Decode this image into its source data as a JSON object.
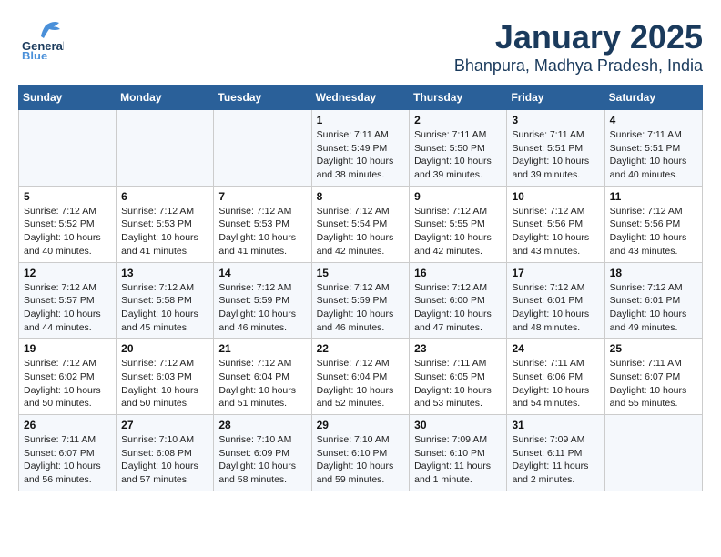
{
  "header": {
    "logo_general": "General",
    "logo_blue": "Blue",
    "title": "January 2025",
    "subtitle": "Bhanpura, Madhya Pradesh, India"
  },
  "days_of_week": [
    "Sunday",
    "Monday",
    "Tuesday",
    "Wednesday",
    "Thursday",
    "Friday",
    "Saturday"
  ],
  "weeks": [
    [
      {
        "day": "",
        "sunrise": "",
        "sunset": "",
        "daylight": ""
      },
      {
        "day": "",
        "sunrise": "",
        "sunset": "",
        "daylight": ""
      },
      {
        "day": "",
        "sunrise": "",
        "sunset": "",
        "daylight": ""
      },
      {
        "day": "1",
        "sunrise": "Sunrise: 7:11 AM",
        "sunset": "Sunset: 5:49 PM",
        "daylight": "Daylight: 10 hours and 38 minutes."
      },
      {
        "day": "2",
        "sunrise": "Sunrise: 7:11 AM",
        "sunset": "Sunset: 5:50 PM",
        "daylight": "Daylight: 10 hours and 39 minutes."
      },
      {
        "day": "3",
        "sunrise": "Sunrise: 7:11 AM",
        "sunset": "Sunset: 5:51 PM",
        "daylight": "Daylight: 10 hours and 39 minutes."
      },
      {
        "day": "4",
        "sunrise": "Sunrise: 7:11 AM",
        "sunset": "Sunset: 5:51 PM",
        "daylight": "Daylight: 10 hours and 40 minutes."
      }
    ],
    [
      {
        "day": "5",
        "sunrise": "Sunrise: 7:12 AM",
        "sunset": "Sunset: 5:52 PM",
        "daylight": "Daylight: 10 hours and 40 minutes."
      },
      {
        "day": "6",
        "sunrise": "Sunrise: 7:12 AM",
        "sunset": "Sunset: 5:53 PM",
        "daylight": "Daylight: 10 hours and 41 minutes."
      },
      {
        "day": "7",
        "sunrise": "Sunrise: 7:12 AM",
        "sunset": "Sunset: 5:53 PM",
        "daylight": "Daylight: 10 hours and 41 minutes."
      },
      {
        "day": "8",
        "sunrise": "Sunrise: 7:12 AM",
        "sunset": "Sunset: 5:54 PM",
        "daylight": "Daylight: 10 hours and 42 minutes."
      },
      {
        "day": "9",
        "sunrise": "Sunrise: 7:12 AM",
        "sunset": "Sunset: 5:55 PM",
        "daylight": "Daylight: 10 hours and 42 minutes."
      },
      {
        "day": "10",
        "sunrise": "Sunrise: 7:12 AM",
        "sunset": "Sunset: 5:56 PM",
        "daylight": "Daylight: 10 hours and 43 minutes."
      },
      {
        "day": "11",
        "sunrise": "Sunrise: 7:12 AM",
        "sunset": "Sunset: 5:56 PM",
        "daylight": "Daylight: 10 hours and 43 minutes."
      }
    ],
    [
      {
        "day": "12",
        "sunrise": "Sunrise: 7:12 AM",
        "sunset": "Sunset: 5:57 PM",
        "daylight": "Daylight: 10 hours and 44 minutes."
      },
      {
        "day": "13",
        "sunrise": "Sunrise: 7:12 AM",
        "sunset": "Sunset: 5:58 PM",
        "daylight": "Daylight: 10 hours and 45 minutes."
      },
      {
        "day": "14",
        "sunrise": "Sunrise: 7:12 AM",
        "sunset": "Sunset: 5:59 PM",
        "daylight": "Daylight: 10 hours and 46 minutes."
      },
      {
        "day": "15",
        "sunrise": "Sunrise: 7:12 AM",
        "sunset": "Sunset: 5:59 PM",
        "daylight": "Daylight: 10 hours and 46 minutes."
      },
      {
        "day": "16",
        "sunrise": "Sunrise: 7:12 AM",
        "sunset": "Sunset: 6:00 PM",
        "daylight": "Daylight: 10 hours and 47 minutes."
      },
      {
        "day": "17",
        "sunrise": "Sunrise: 7:12 AM",
        "sunset": "Sunset: 6:01 PM",
        "daylight": "Daylight: 10 hours and 48 minutes."
      },
      {
        "day": "18",
        "sunrise": "Sunrise: 7:12 AM",
        "sunset": "Sunset: 6:01 PM",
        "daylight": "Daylight: 10 hours and 49 minutes."
      }
    ],
    [
      {
        "day": "19",
        "sunrise": "Sunrise: 7:12 AM",
        "sunset": "Sunset: 6:02 PM",
        "daylight": "Daylight: 10 hours and 50 minutes."
      },
      {
        "day": "20",
        "sunrise": "Sunrise: 7:12 AM",
        "sunset": "Sunset: 6:03 PM",
        "daylight": "Daylight: 10 hours and 50 minutes."
      },
      {
        "day": "21",
        "sunrise": "Sunrise: 7:12 AM",
        "sunset": "Sunset: 6:04 PM",
        "daylight": "Daylight: 10 hours and 51 minutes."
      },
      {
        "day": "22",
        "sunrise": "Sunrise: 7:12 AM",
        "sunset": "Sunset: 6:04 PM",
        "daylight": "Daylight: 10 hours and 52 minutes."
      },
      {
        "day": "23",
        "sunrise": "Sunrise: 7:11 AM",
        "sunset": "Sunset: 6:05 PM",
        "daylight": "Daylight: 10 hours and 53 minutes."
      },
      {
        "day": "24",
        "sunrise": "Sunrise: 7:11 AM",
        "sunset": "Sunset: 6:06 PM",
        "daylight": "Daylight: 10 hours and 54 minutes."
      },
      {
        "day": "25",
        "sunrise": "Sunrise: 7:11 AM",
        "sunset": "Sunset: 6:07 PM",
        "daylight": "Daylight: 10 hours and 55 minutes."
      }
    ],
    [
      {
        "day": "26",
        "sunrise": "Sunrise: 7:11 AM",
        "sunset": "Sunset: 6:07 PM",
        "daylight": "Daylight: 10 hours and 56 minutes."
      },
      {
        "day": "27",
        "sunrise": "Sunrise: 7:10 AM",
        "sunset": "Sunset: 6:08 PM",
        "daylight": "Daylight: 10 hours and 57 minutes."
      },
      {
        "day": "28",
        "sunrise": "Sunrise: 7:10 AM",
        "sunset": "Sunset: 6:09 PM",
        "daylight": "Daylight: 10 hours and 58 minutes."
      },
      {
        "day": "29",
        "sunrise": "Sunrise: 7:10 AM",
        "sunset": "Sunset: 6:10 PM",
        "daylight": "Daylight: 10 hours and 59 minutes."
      },
      {
        "day": "30",
        "sunrise": "Sunrise: 7:09 AM",
        "sunset": "Sunset: 6:10 PM",
        "daylight": "Daylight: 11 hours and 1 minute."
      },
      {
        "day": "31",
        "sunrise": "Sunrise: 7:09 AM",
        "sunset": "Sunset: 6:11 PM",
        "daylight": "Daylight: 11 hours and 2 minutes."
      },
      {
        "day": "",
        "sunrise": "",
        "sunset": "",
        "daylight": ""
      }
    ]
  ]
}
